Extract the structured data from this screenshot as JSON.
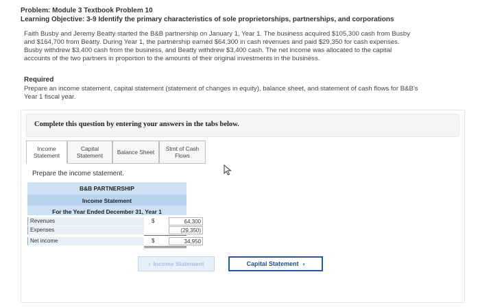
{
  "problem_title": "Problem: Module 3 Textbook Problem 10",
  "learning_objective": "Learning Objective: 3-9 Identify the primary characteristics of sole proprietorships, partnerships, and corporations",
  "scenario_lines": [
    "Faith Busby and Jeremy Beatty started the B&B partnership on January 1, Year 1. The business acquired $105,300 cash from Busby",
    "and $164,700 from Beatty. During Year 1, the partnership earned $64,300 in cash revenues and paid $29,350 for cash expenses.",
    "Busby withdrew $3,400 cash from the business, and Beatty withdrew $3,400 cash. The net income was allocated to the capital",
    "accounts of the two partners in proportion to the amounts of their original investments in the business."
  ],
  "required_label": "Required",
  "required_lines": [
    "Prepare an income statement, capital statement (statement of changes in equity), balance sheet, and statement of cash flows for B&B's",
    "Year 1 fiscal year."
  ],
  "complete_instruction": "Complete this question by entering your answers in the tabs below.",
  "tabs": [
    {
      "line1": "Income",
      "line2": "Statement",
      "active": true
    },
    {
      "line1": "Capital",
      "line2": "Statement",
      "active": false
    },
    {
      "line1": "Balance Sheet",
      "line2": "",
      "active": false
    },
    {
      "line1": "Stmt of Cash",
      "line2": "Flows",
      "active": false
    }
  ],
  "prompt": "Prepare the income statement.",
  "statement": {
    "company": "B&B PARTNERSHIP",
    "name": "Income Statement",
    "period": "For the Year Ended December 31, Year 1",
    "rows": [
      {
        "label": "Revenues",
        "currency": "$",
        "amount": "64,300"
      },
      {
        "label": "Expenses",
        "currency": "",
        "amount": "(29,350)"
      },
      {
        "label": "Net income",
        "currency": "$",
        "amount": "34,950"
      }
    ]
  },
  "nav": {
    "prev_label": "Income Statement",
    "next_label": "Capital Statement",
    "prev_icon": "chevron-left-icon",
    "next_icon": "chevron-right-icon"
  },
  "colors": {
    "header_band": "#cde1f2",
    "next_button_border": "#1f5c9f",
    "next_button_text": "#1d4f8a"
  }
}
